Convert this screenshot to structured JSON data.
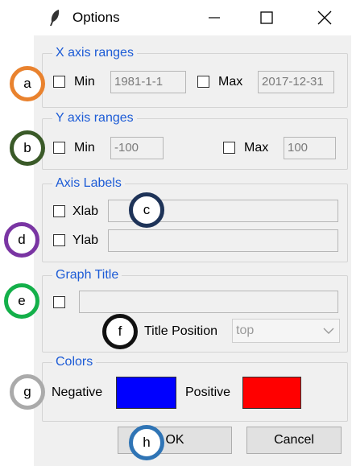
{
  "window": {
    "title": "Options",
    "icon": "feather-icon"
  },
  "x_axis": {
    "group_title": "X axis ranges",
    "min_label": "Min",
    "min_value": "1981-1-1",
    "max_label": "Max",
    "max_value": "2017-12-31"
  },
  "y_axis": {
    "group_title": "Y axis ranges",
    "min_label": "Min",
    "min_value": "-100",
    "max_label": "Max",
    "max_value": "100"
  },
  "axis_labels": {
    "group_title": "Axis Labels",
    "xlab_label": "Xlab",
    "xlab_value": "",
    "ylab_label": "Ylab",
    "ylab_value": ""
  },
  "graph_title": {
    "group_title": "Graph Title",
    "title_value": "",
    "position_label": "Title Position",
    "position_value": "top"
  },
  "colors": {
    "group_title": "Colors",
    "negative_label": "Negative",
    "negative_color": "#0000ff",
    "positive_label": "Positive",
    "positive_color": "#ff0000"
  },
  "buttons": {
    "ok": "OK",
    "cancel": "Cancel"
  },
  "markers": [
    {
      "letter": "a",
      "color": "#e9822e"
    },
    {
      "letter": "b",
      "color": "#3a5a28"
    },
    {
      "letter": "c",
      "color": "#1e3358"
    },
    {
      "letter": "d",
      "color": "#7a35a3"
    },
    {
      "letter": "e",
      "color": "#14b04a"
    },
    {
      "letter": "f",
      "color": "#111111"
    },
    {
      "letter": "g",
      "color": "#aaaaaa"
    },
    {
      "letter": "h",
      "color": "#2f74b5"
    }
  ]
}
